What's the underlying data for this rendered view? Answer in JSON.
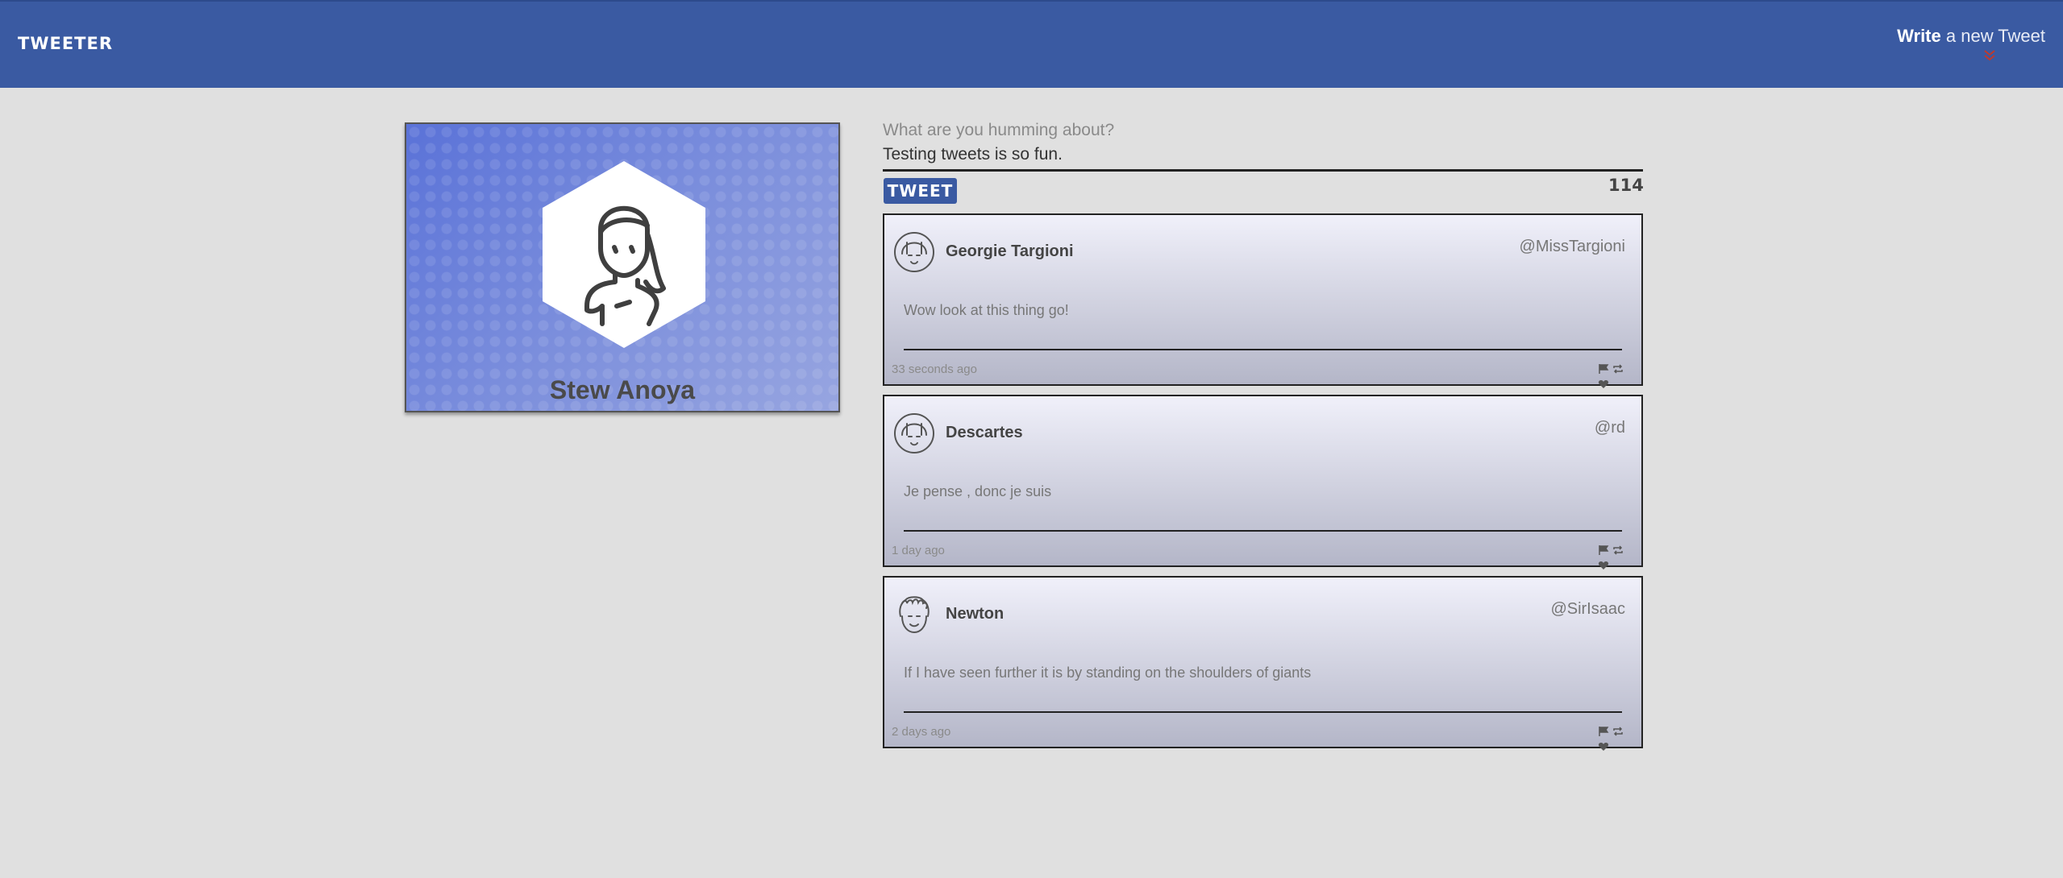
{
  "nav": {
    "brand": "TWEETER",
    "compose_bold": "Write",
    "compose_rest": "a new Tweet",
    "chevron_icon": "double-chevron-down-icon",
    "chevron_color": "#c0392b"
  },
  "profile": {
    "name": "Stew Anoya",
    "avatar_icon": "woman-avatar-icon"
  },
  "composer": {
    "placeholder": "What are you humming about?",
    "value": "Testing tweets is so fun.",
    "button_label": "TWEET",
    "char_count": "114"
  },
  "tweets": [
    {
      "name": "Georgie Targioni",
      "handle": "@MissTargioni",
      "text": "Wow look at this thing go!",
      "time": "33 seconds ago",
      "avatar_icon": "girl-avatar-icon"
    },
    {
      "name": "Descartes",
      "handle": "@rd",
      "text": "Je pense , donc je suis",
      "time": "1 day ago",
      "avatar_icon": "girl-avatar-icon"
    },
    {
      "name": "Newton",
      "handle": "@SirIsaac",
      "text": "If I have seen further it is by standing on the shoulders of giants",
      "time": "2 days ago",
      "avatar_icon": "curly-hair-avatar-icon"
    }
  ],
  "tweet_actions": [
    "flag-icon",
    "retweet-icon",
    "heart-icon"
  ],
  "colors": {
    "nav_bg": "#3a5aa2",
    "page_bg": "#e0e0e0",
    "profile_gradient_start": "#5a72d8",
    "profile_gradient_end": "#97a5e0"
  }
}
